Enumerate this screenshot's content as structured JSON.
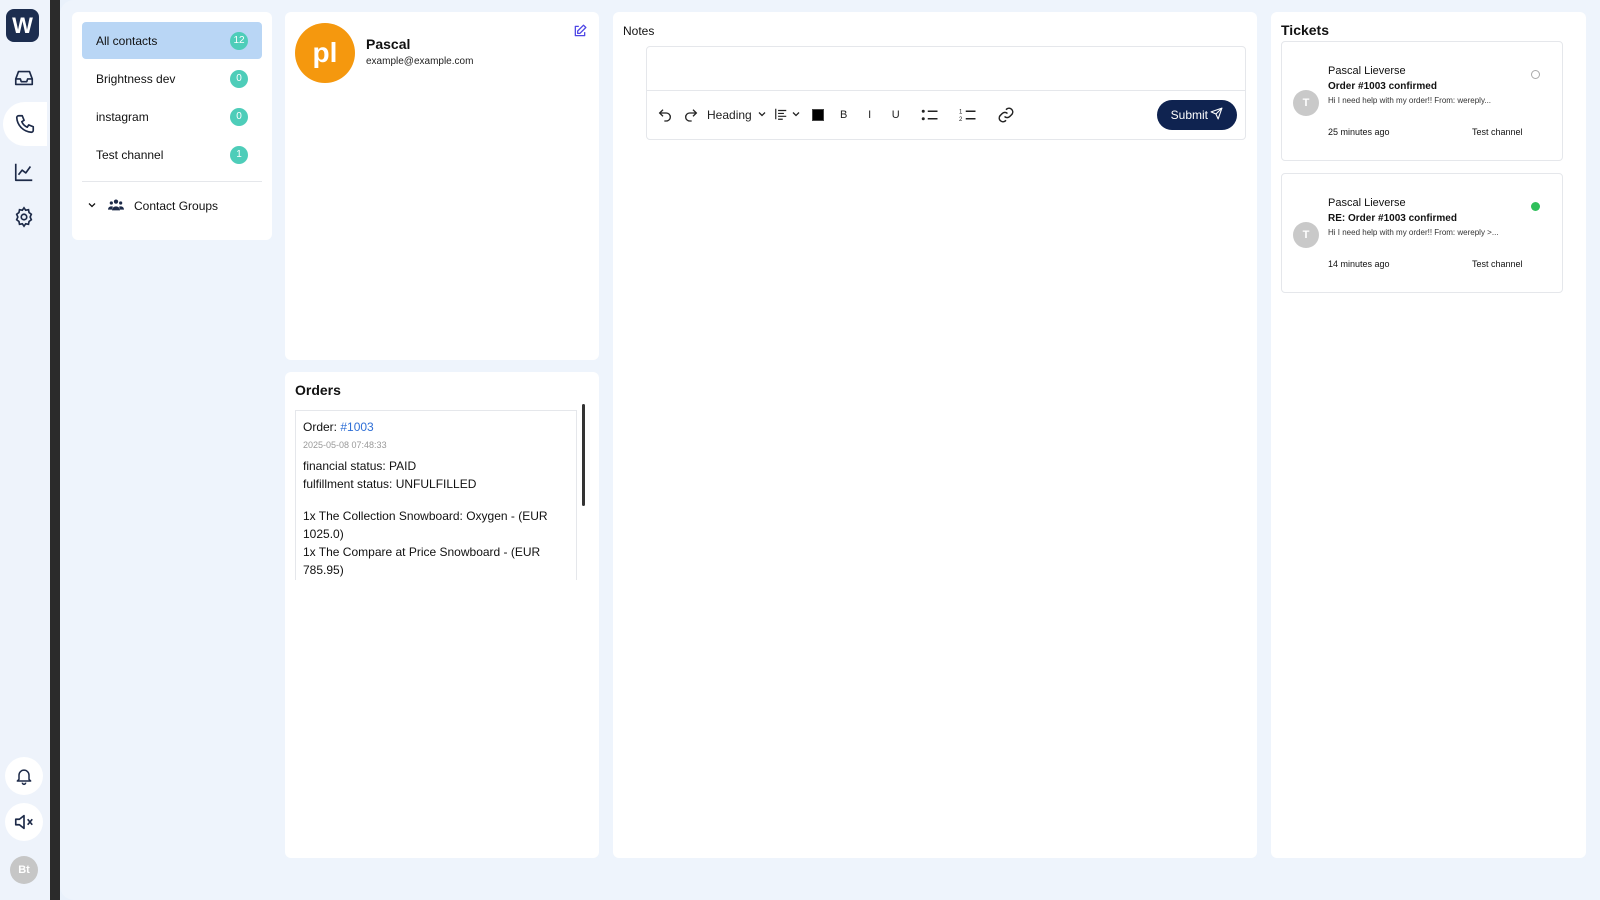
{
  "rail": {
    "logo": "W",
    "user_initials": "Bt"
  },
  "contacts": {
    "items": [
      {
        "label": "All contacts",
        "count": "12"
      },
      {
        "label": "Brightness dev",
        "count": "0"
      },
      {
        "label": "instagram",
        "count": "0"
      },
      {
        "label": "Test channel",
        "count": "1"
      }
    ],
    "groups_label": "Contact Groups"
  },
  "profile": {
    "initials": "pl",
    "name": "Pascal",
    "email": "example@example.com"
  },
  "orders": {
    "title": "Orders",
    "order_prefix": "Order: ",
    "order_number": "#1003",
    "date": "2025-05-08 07:48:33",
    "financial_status": "financial status: PAID",
    "fulfillment_status": "fulfillment status: UNFULFILLED",
    "line1": "1x The Collection Snowboard: Oxygen - (EUR 1025.0)",
    "line2": "1x The Compare at Price Snowboard - (EUR 785.95)"
  },
  "notes": {
    "title": "Notes",
    "heading_select": "Heading",
    "bold": "B",
    "italic": "I",
    "underline": "U",
    "submit_label": "Submit"
  },
  "tickets": {
    "title": "Tickets",
    "items": [
      {
        "avatar": "T",
        "name": "Pascal Lieverse",
        "subject": "Order #1003 confirmed",
        "preview": "Hi I need help with my order!! From: wereply...",
        "time": "25 minutes ago",
        "channel": "Test channel",
        "status": "unread"
      },
      {
        "avatar": "T",
        "name": "Pascal Lieverse",
        "subject": "RE: Order #1003 confirmed",
        "preview": "Hi I need help with my order!! From: wereply >...",
        "time": "14 minutes ago",
        "channel": "Test channel",
        "status": "active"
      }
    ]
  },
  "colors": {
    "accent_dark": "#0f2350",
    "badge": "#4ecdb9",
    "avatar_orange": "#f5980e",
    "active_green": "#2fbf5b"
  }
}
